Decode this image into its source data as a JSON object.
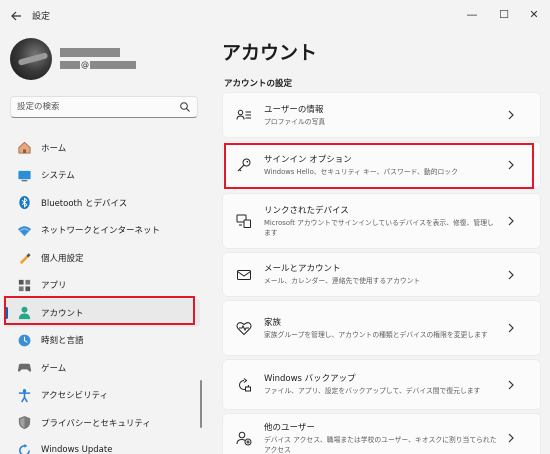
{
  "window": {
    "title": "設定",
    "back_icon": "back-arrow-icon",
    "minimize_symbol": "—",
    "maximize_symbol": "☐",
    "close_symbol": "✕"
  },
  "profile": {
    "email_at": "@"
  },
  "search": {
    "placeholder": "設定の検索"
  },
  "sidebar": {
    "items": [
      {
        "label": "ホーム",
        "icon": "home-icon"
      },
      {
        "label": "システム",
        "icon": "system-icon"
      },
      {
        "label": "Bluetooth とデバイス",
        "icon": "bluetooth-icon"
      },
      {
        "label": "ネットワークとインターネット",
        "icon": "network-icon"
      },
      {
        "label": "個人用設定",
        "icon": "personalization-icon"
      },
      {
        "label": "アプリ",
        "icon": "apps-icon"
      },
      {
        "label": "アカウント",
        "icon": "account-icon",
        "selected": true
      },
      {
        "label": "時刻と言語",
        "icon": "time-language-icon"
      },
      {
        "label": "ゲーム",
        "icon": "gaming-icon"
      },
      {
        "label": "アクセシビリティ",
        "icon": "accessibility-icon"
      },
      {
        "label": "プライバシーとセキュリティ",
        "icon": "privacy-icon"
      },
      {
        "label": "Windows Update",
        "icon": "windows-update-icon"
      }
    ]
  },
  "main": {
    "title": "アカウント",
    "section_title": "アカウントの設定",
    "cards": [
      {
        "title": "ユーザーの情報",
        "desc": "プロファイルの写真",
        "icon": "user-info-icon"
      },
      {
        "title": "サインイン オプション",
        "desc": "Windows Hello、セキュリティ キー、パスワード、動的ロック",
        "icon": "key-icon"
      },
      {
        "title": "リンクされたデバイス",
        "desc": "Microsoft アカウントでサインインしているデバイスを表示、修復、管理します",
        "icon": "linked-devices-icon"
      },
      {
        "title": "メールとアカウント",
        "desc": "メール、カレンダー、連絡先で使用するアカウント",
        "icon": "mail-icon"
      },
      {
        "title": "家族",
        "desc": "家族グループを管理し、アカウントの種類とデバイスの権限を変更します",
        "icon": "family-icon"
      },
      {
        "title": "Windows バックアップ",
        "desc": "ファイル、アプリ、設定をバックアップして、デバイス間で復元します",
        "icon": "backup-icon"
      },
      {
        "title": "他のユーザー",
        "desc": "デバイス アクセス、職場または学校のユーザー、キオスクに割り当てられたアクセス",
        "icon": "other-users-icon"
      }
    ]
  },
  "colors": {
    "accent": "#0067c0",
    "highlight": "#e0192a",
    "background": "#f3f3f3",
    "card": "#fbfbfb"
  }
}
